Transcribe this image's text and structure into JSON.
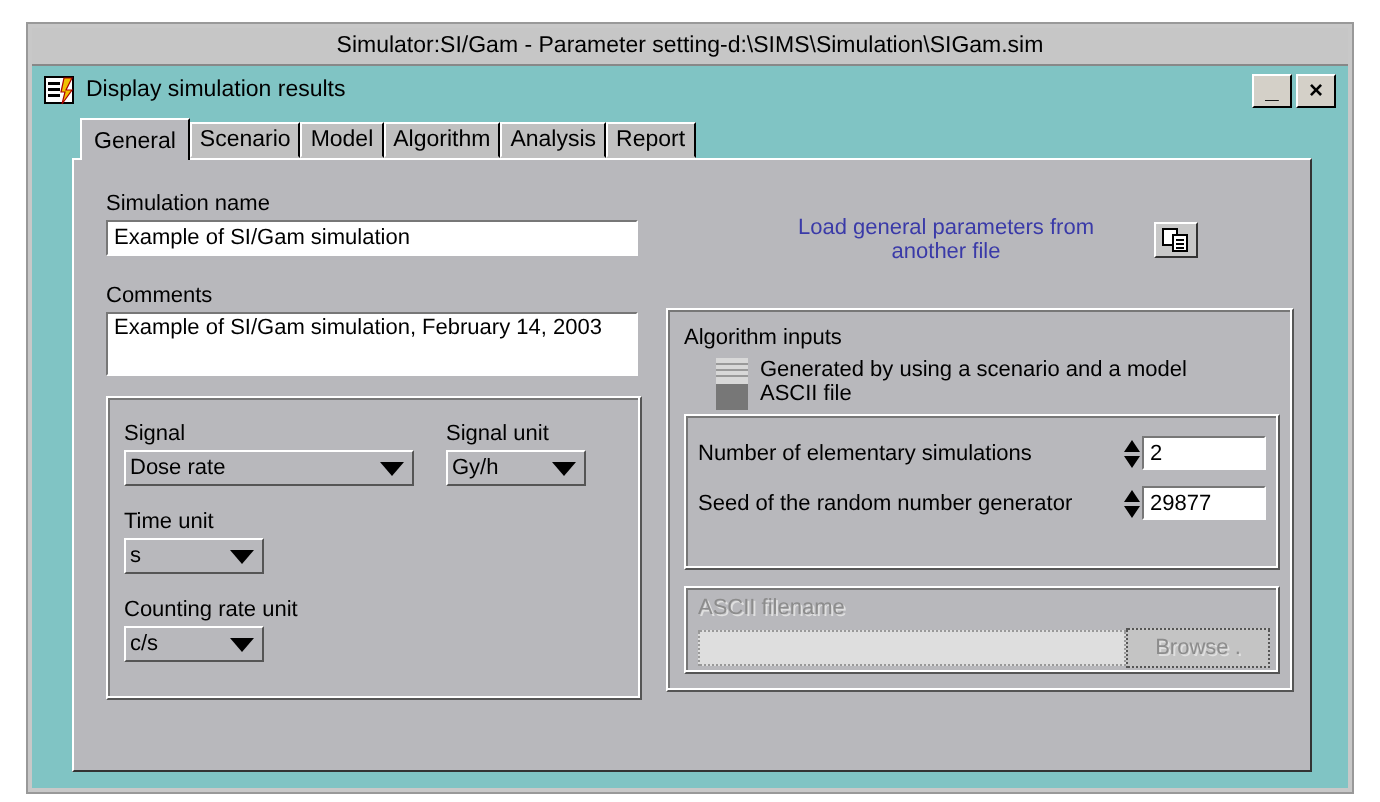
{
  "window": {
    "title": "Simulator:SI/Gam - Parameter setting-d:\\SIMS\\Simulation\\SIGam.sim"
  },
  "subwindow": {
    "title": "Display simulation results",
    "buttons": [
      {
        "kind": "minimize",
        "label": "_"
      },
      {
        "kind": "close",
        "label": "×"
      }
    ]
  },
  "tabs": [
    {
      "label": "General",
      "selected": true
    },
    {
      "label": "Scenario",
      "selected": false
    },
    {
      "label": "Model",
      "selected": false
    },
    {
      "label": "Algorithm",
      "selected": false
    },
    {
      "label": "Analysis",
      "selected": false
    },
    {
      "label": "Report",
      "selected": false
    }
  ],
  "simulation_name": {
    "label": "Simulation name",
    "value": "Example of SI/Gam simulation"
  },
  "comments": {
    "label": "Comments",
    "value": "Example of SI/Gam simulation, February 14, 2003"
  },
  "load_link": "Load general parameters from another file",
  "units": [
    {
      "label": "Signal",
      "value": "Dose rate",
      "kind": "wide"
    },
    {
      "label": "Signal unit",
      "value": "Gy/h",
      "kind": "narrow"
    },
    {
      "label": "Time unit",
      "value": "s",
      "kind": "narrow"
    },
    {
      "label": "Counting rate unit",
      "value": "c/s",
      "kind": "narrow"
    }
  ],
  "algorithm_inputs": {
    "label": "Algorithm inputs",
    "options": [
      "Generated by using a scenario and a model",
      "ASCII file"
    ],
    "fields": [
      {
        "label": "Number of elementary simulations",
        "value": "2"
      },
      {
        "label": "Seed of the random number generator",
        "value": "29877"
      }
    ]
  },
  "ascii_filename": {
    "label": "ASCII filename",
    "button": "Browse .",
    "disabled": true
  }
}
